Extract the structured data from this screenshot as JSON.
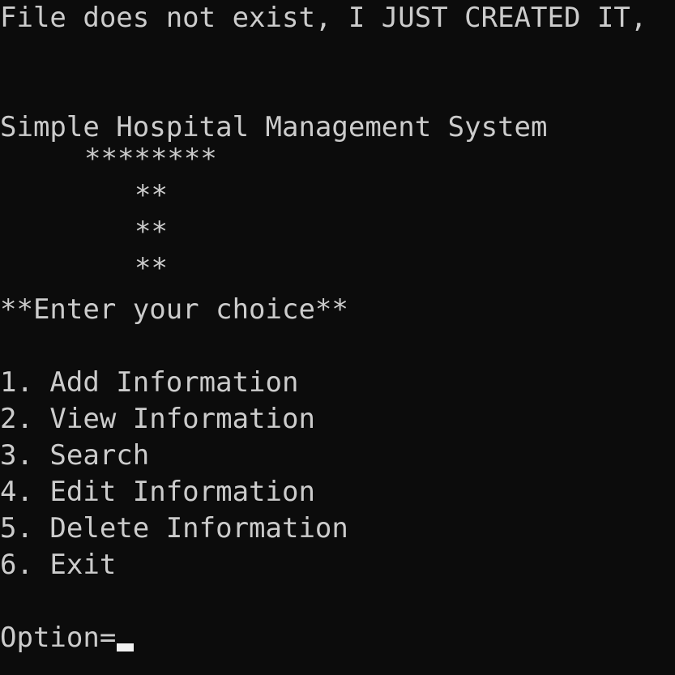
{
  "console": {
    "status_line": "File does not exist, I JUST CREATED IT,",
    "title": "Simple Hospital Management System",
    "art": [
      "********",
      "**",
      "**",
      "**"
    ],
    "prompt_heading": "**Enter your choice**",
    "menu": [
      "1. Add Information",
      "2. View Information",
      "3. Search",
      "4. Edit Information",
      "5. Delete Information",
      "6. Exit"
    ],
    "input_label": "Option=",
    "input_value": ""
  },
  "colors": {
    "background": "#0c0c0c",
    "text": "#cccccc",
    "cursor": "#f2f2f2"
  }
}
